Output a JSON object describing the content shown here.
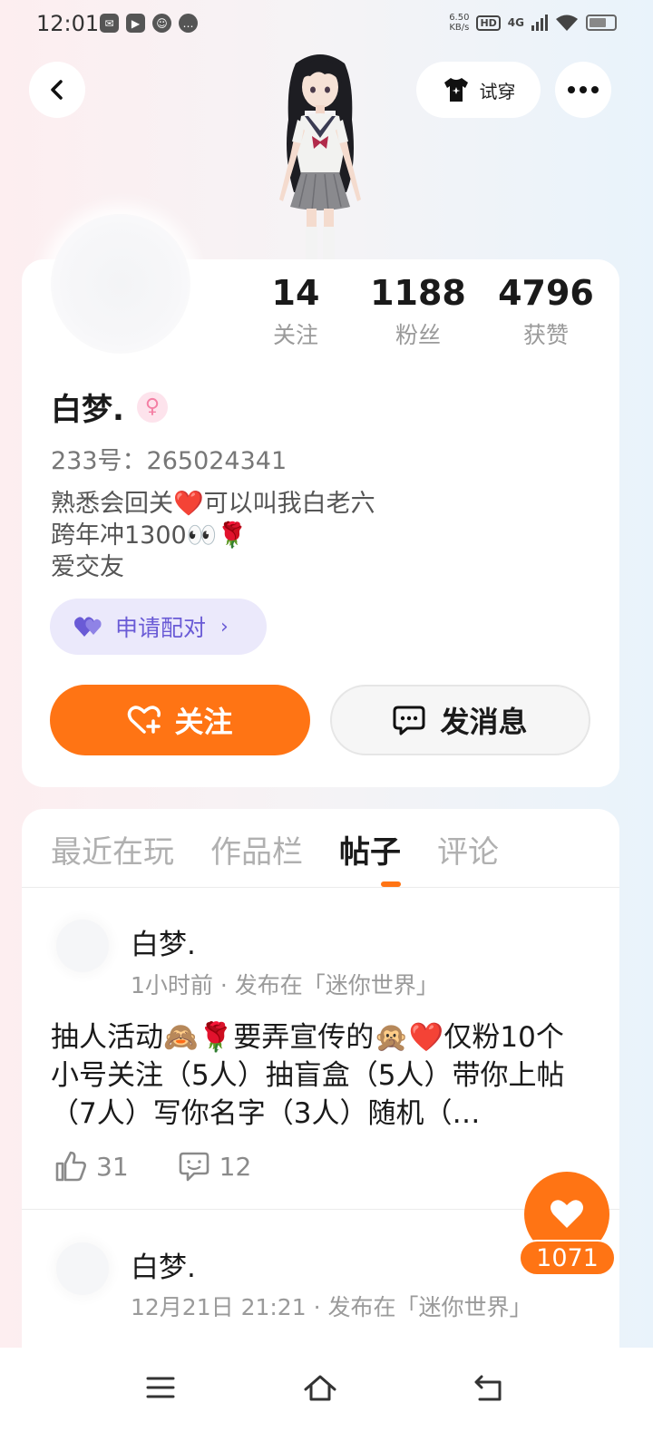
{
  "status_bar": {
    "time": "12:01",
    "net_speed_value": "6.50",
    "net_speed_unit": "KB/s",
    "hd": "HD",
    "network": "4G"
  },
  "header": {
    "tryon_label": "试穿"
  },
  "profile": {
    "stats": [
      {
        "value": "14",
        "label": "关注"
      },
      {
        "value": "1188",
        "label": "粉丝"
      },
      {
        "value": "4796",
        "label": "获赞"
      }
    ],
    "name": "白梦.",
    "gender_symbol": "♀",
    "id_line": "233号：265024341",
    "bio": [
      "熟悉会回关❤️可以叫我白老六",
      "跨年冲1300👀🌹",
      "爱交友"
    ],
    "pair_label": "申请配对",
    "follow_label": "关注",
    "message_label": "发消息"
  },
  "tabs": [
    {
      "label": "最近在玩"
    },
    {
      "label": "作品栏"
    },
    {
      "label": "帖子"
    },
    {
      "label": "评论"
    }
  ],
  "posts": [
    {
      "author": "白梦.",
      "meta": "1小时前 · 发布在「迷你世界」",
      "text": "抽人活动🙈🌹要弄宣传的🙊❤️仅粉10个小号关注（5人）抽盲盒（5人）带你上帖（7人）写你名字（3人）随机（…",
      "likes": "31",
      "comments": "12"
    },
    {
      "author": "白梦.",
      "meta": "12月21日 21:21 · 发布在「迷你世界」"
    }
  ],
  "floating_like_count": "1071",
  "colors": {
    "accent": "#ff7414",
    "pair_bg": "#ebe9fb",
    "pair_text": "#6a5bd6"
  }
}
